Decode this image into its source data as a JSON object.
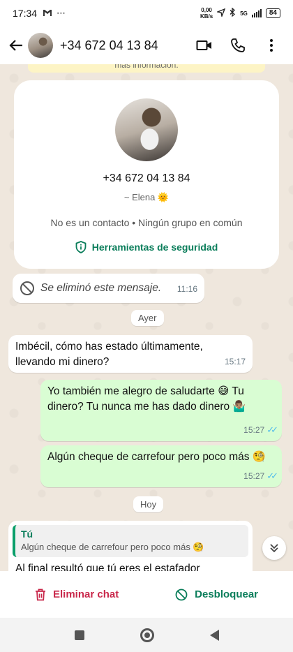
{
  "status_bar": {
    "time": "17:34",
    "speed_top": "0,00",
    "speed_bottom": "KB/s",
    "network": "5G",
    "battery": "84"
  },
  "header": {
    "title": "+34 672 04 13 84"
  },
  "chat": {
    "info_strip": "más información.",
    "profile": {
      "phone": "+34 672 04 13 84",
      "name": "~ Elena 🌞",
      "subtitle": "No es un contacto • Ningún grupo en común",
      "security_label": "Herramientas de seguridad"
    },
    "deleted_message": {
      "text": "Se eliminó este mensaje.",
      "time": "11:16"
    },
    "day_yesterday": "Ayer",
    "messages": [
      {
        "text": "Imbécil, cómo has estado últimamente, llevando mi dinero?",
        "time": "15:17"
      },
      {
        "text": "Yo también me alegro de saludarte 😅 Tu dinero? Tu nunca me has dado dinero 🤷🏽‍♂️",
        "time": "15:27"
      },
      {
        "text": "Algún cheque de carrefour pero poco más 🧐",
        "time": "15:27"
      }
    ],
    "day_today": "Hoy",
    "reply": {
      "quote_author": "Tú",
      "quote_text": "Algún cheque de carrefour pero poco más 🧐",
      "text": "Al final resultó que tú eres el estafador"
    }
  },
  "actions": {
    "delete_label": "Eliminar chat",
    "unblock_label": "Desbloquear"
  },
  "colors": {
    "accent_green": "#0a7d5a",
    "danger_red": "#c9284b",
    "outgoing_bubble": "#d9fdd3",
    "read_ticks": "#53bdeb"
  }
}
